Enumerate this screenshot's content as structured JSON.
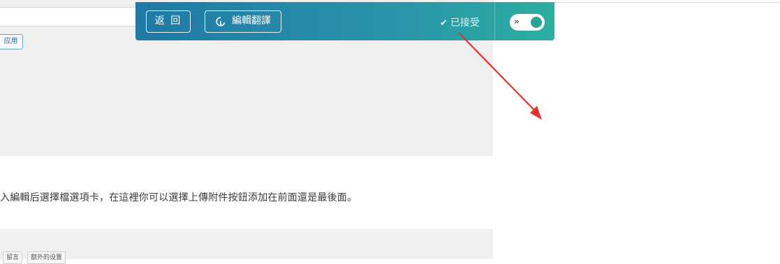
{
  "content": {
    "apply_label": "应用",
    "body_text": "入編輯后選擇檔選項卡，在這裡你可以選擇上傳附件按鈕添加在前面還是最後面。",
    "tabs": [
      "留言",
      "额外的设置"
    ]
  },
  "toolbar": {
    "back_label": "返 回",
    "edit_label": "編輯翻譯",
    "accepted_label": "已接受",
    "toggle_on": true,
    "colors": {
      "start": "#1f79a6",
      "end": "#2caea0",
      "knob": "#2aa296"
    }
  },
  "annotation": {
    "arrow_color": "#e8312a"
  }
}
